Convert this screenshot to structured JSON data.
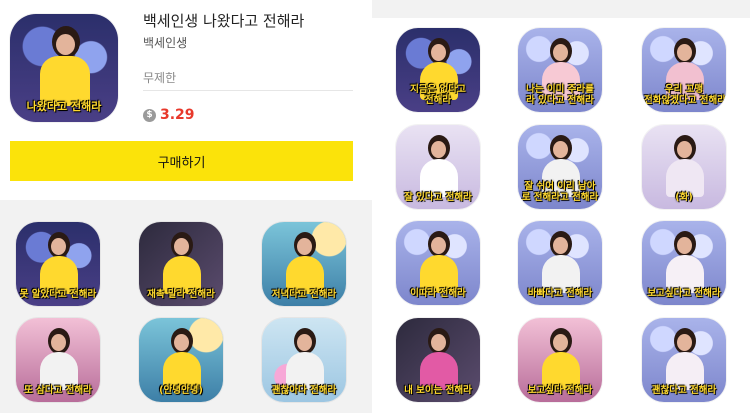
{
  "product": {
    "title": "백세인생 나왔다고 전해라",
    "subtitle": "백세인생",
    "duration": "무제한",
    "price": "3.29",
    "currency_icon": "$",
    "price_color": "#e8382b",
    "buy_label": "구매하기",
    "buy_color": "#fbe30a",
    "thumb_caption": "나왔다고 전해라"
  },
  "right_stickers": [
    {
      "caption": "지금은 없다고",
      "caption2": "전해라",
      "bg": "bg-stage1",
      "body": "#ffd92e"
    },
    {
      "caption": "나는 이미 주라를",
      "caption2": "라 있다고 전해라",
      "bg": "bg-stage2",
      "body": "#f7c9d4"
    },
    {
      "caption": "우리 꼬맹",
      "caption2": "전화않겠다고 전해라",
      "bg": "bg-stage2",
      "body": "#f2c0d0"
    },
    {
      "caption": "잘 있다고 전해라",
      "caption2": "",
      "bg": "bg-stage6",
      "body": "#ffffff"
    },
    {
      "caption": "잘 쉬어 이리 남아",
      "caption2": "로 전해라고 전해라",
      "bg": "bg-stage2",
      "body": "#f2f2f2"
    },
    {
      "caption": "(화)",
      "caption2": "",
      "bg": "bg-stage6",
      "body": "#efe7f3"
    },
    {
      "caption": "이따라 전해라",
      "caption2": "",
      "bg": "bg-stage2",
      "body": "#ffd92e"
    },
    {
      "caption": "바빠다고 전해라",
      "caption2": "",
      "bg": "bg-stage2",
      "body": "#f2f2f2"
    },
    {
      "caption": "보고싶다고 전해라",
      "caption2": "",
      "bg": "bg-stage2",
      "body": "#f6f0f6"
    },
    {
      "caption": "내 보이는 전해라",
      "caption2": "",
      "bg": "bg-stage3",
      "body": "#e25aa5"
    },
    {
      "caption": "보고싶다 전해라",
      "caption2": "",
      "bg": "bg-pink",
      "body": "#ffd92e"
    },
    {
      "caption": "괜찮다고 전해라",
      "caption2": "",
      "bg": "bg-stage2",
      "body": "#f5eef5"
    }
  ],
  "left_stickers": [
    {
      "caption": "못 알았다고 전해라",
      "bg": "bg-stage1",
      "body": "#ffd92e"
    },
    {
      "caption": "재촉 말라 전해라",
      "bg": "bg-stage3",
      "body": "#ffd92e"
    },
    {
      "caption": "저녁다고 전해라",
      "bg": "bg-stage4",
      "body": "#ffd92e"
    },
    {
      "caption": "또 삼다고 전해라",
      "bg": "bg-pink",
      "body": "#f2f2f2"
    },
    {
      "caption": "(안녕안녕)",
      "bg": "bg-stage4",
      "body": "#ffd92e"
    },
    {
      "caption": "괜찮아다 전해라",
      "bg": "bg-stage5",
      "body": "#f2f2f2"
    }
  ]
}
